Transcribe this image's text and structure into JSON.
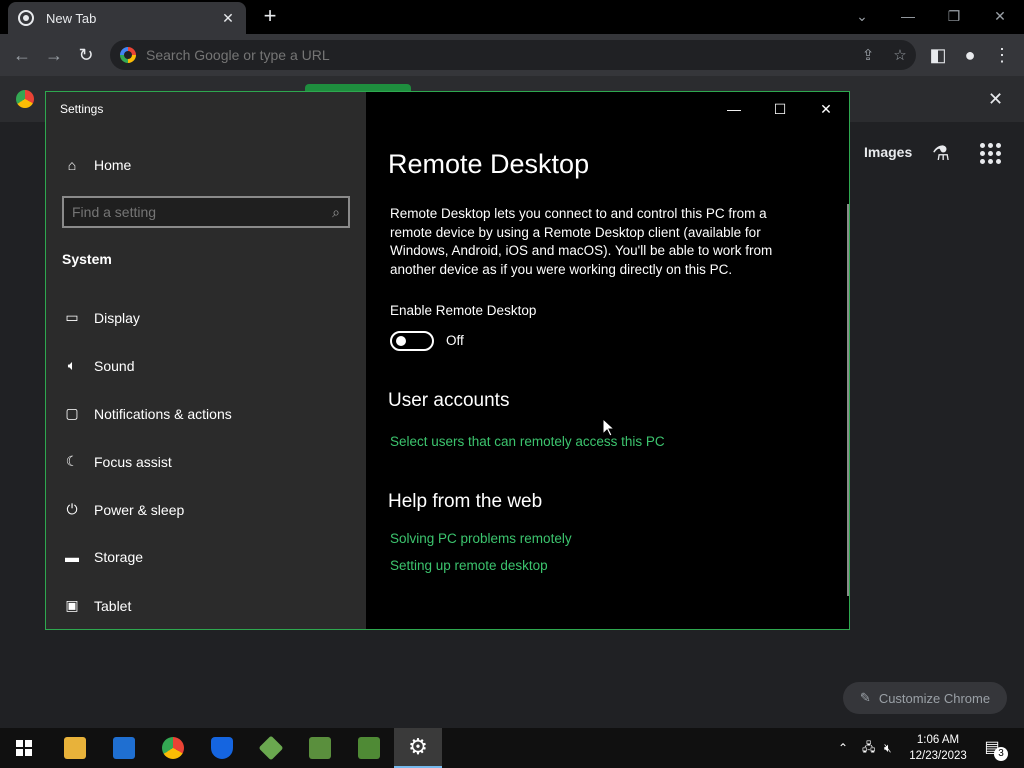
{
  "browser": {
    "tab_title": "New Tab",
    "tab_close": "✕",
    "new_tab": "+",
    "omnibox_placeholder": "Search Google or type a URL",
    "ntp_close": "✕",
    "ntp_images": "Images",
    "customize_label": "Customize Chrome"
  },
  "settings": {
    "window_title": "Settings",
    "home_label": "Home",
    "search_placeholder": "Find a setting",
    "section_label": "System",
    "nav_items": [
      {
        "label": "Display",
        "icon": "monitor-icon"
      },
      {
        "label": "Sound",
        "icon": "speaker-icon"
      },
      {
        "label": "Notifications & actions",
        "icon": "notification-icon"
      },
      {
        "label": "Focus assist",
        "icon": "moon-icon"
      },
      {
        "label": "Power & sleep",
        "icon": "power-icon"
      },
      {
        "label": "Storage",
        "icon": "storage-icon"
      },
      {
        "label": "Tablet",
        "icon": "tablet-icon"
      }
    ],
    "page_title": "Remote Desktop",
    "description": "Remote Desktop lets you connect to and control this PC from a remote device by using a Remote Desktop client (available for Windows, Android, iOS and macOS). You'll be able to work from another device as if you were working directly on this PC.",
    "enable_label": "Enable Remote Desktop",
    "toggle_state": "Off",
    "toggle_on": false,
    "user_accounts_heading": "User accounts",
    "user_accounts_link": "Select users that can remotely access this PC",
    "help_heading": "Help from the web",
    "help_links": [
      "Solving PC problems remotely",
      "Setting up remote desktop"
    ],
    "accent_color": "#3cc46e"
  },
  "taskbar": {
    "time": "1:06 AM",
    "date": "12/23/2023",
    "notification_count": "3"
  }
}
